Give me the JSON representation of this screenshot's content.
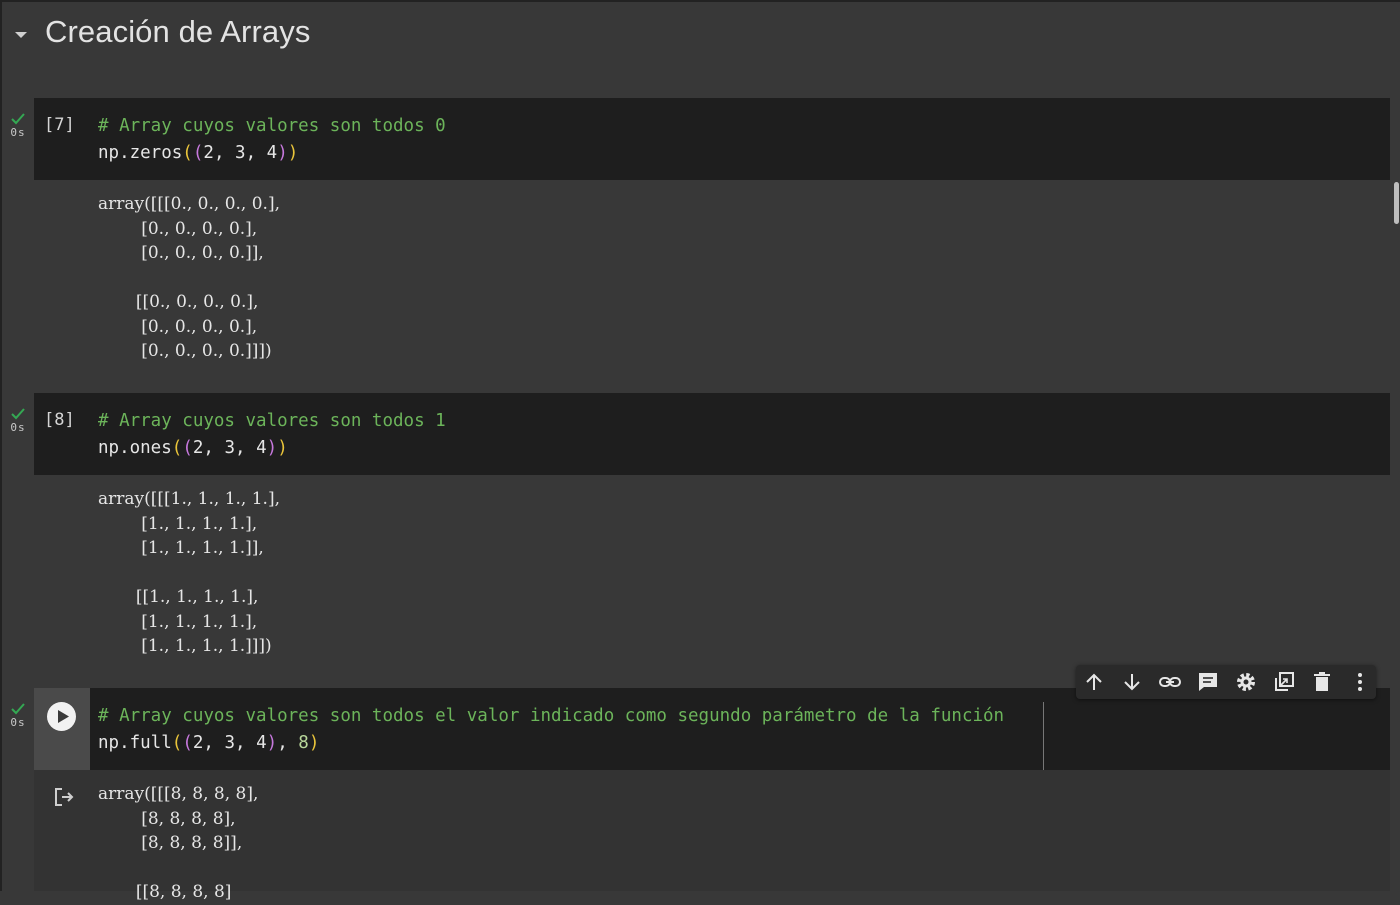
{
  "section": {
    "title": "Creación de Arrays"
  },
  "cells": [
    {
      "exec_count": "[7]",
      "status_time": "0s",
      "comment": "# Array cuyos valores son todos 0",
      "code_func": "np.zeros",
      "code_args": [
        "2",
        "3",
        "4"
      ],
      "output": "array([[[0., 0., 0., 0.],\n        [0., 0., 0., 0.],\n        [0., 0., 0., 0.]],\n\n       [[0., 0., 0., 0.],\n        [0., 0., 0., 0.],\n        [0., 0., 0., 0.]]])"
    },
    {
      "exec_count": "[8]",
      "status_time": "0s",
      "comment": "# Array cuyos valores son todos 1",
      "code_func": "np.ones",
      "code_args": [
        "2",
        "3",
        "4"
      ],
      "output": "array([[[1., 1., 1., 1.],\n        [1., 1., 1., 1.],\n        [1., 1., 1., 1.]],\n\n       [[1., 1., 1., 1.],\n        [1., 1., 1., 1.],\n        [1., 1., 1., 1.]]])"
    },
    {
      "status_time": "0s",
      "comment": "# Array cuyos valores son todos el valor indicado como segundo parámetro de la función",
      "code_func": "np.full",
      "code_args": [
        "2",
        "3",
        "4"
      ],
      "code_extra_arg": "8",
      "output": "array([[[8, 8, 8, 8],\n        [8, 8, 8, 8],\n        [8, 8, 8, 8]],\n\n       [[8, 8, 8, 8]"
    }
  ],
  "toolbar": {
    "items": [
      "arrow-up-icon",
      "arrow-down-icon",
      "link-icon",
      "comment-icon",
      "gear-icon",
      "mirror-cell-icon",
      "trash-icon",
      "more-vert-icon"
    ]
  },
  "colors": {
    "background": "#383838",
    "code_bg": "#1e1e1e",
    "comment": "#6cb45a",
    "paren_outer": "#e9c43a",
    "paren_inner": "#c678dd",
    "number": "#b9d89b",
    "check": "#34a853"
  }
}
